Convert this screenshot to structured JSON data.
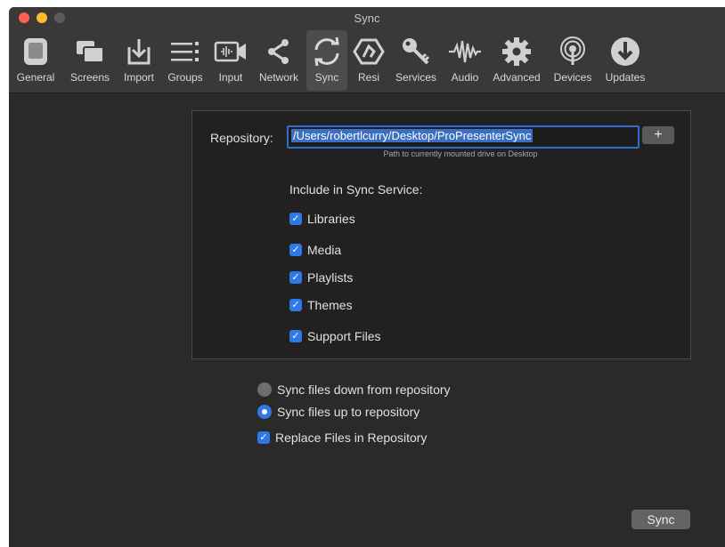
{
  "window": {
    "title": "Sync"
  },
  "toolbar": {
    "items": [
      {
        "label": "General",
        "icon": "general-icon"
      },
      {
        "label": "Screens",
        "icon": "screens-icon"
      },
      {
        "label": "Import",
        "icon": "import-icon"
      },
      {
        "label": "Groups",
        "icon": "groups-icon"
      },
      {
        "label": "Input",
        "icon": "input-icon"
      },
      {
        "label": "Network",
        "icon": "network-icon"
      },
      {
        "label": "Sync",
        "icon": "sync-icon",
        "active": true
      },
      {
        "label": "Resi",
        "icon": "resi-icon"
      },
      {
        "label": "Services",
        "icon": "key-icon"
      },
      {
        "label": "Audio",
        "icon": "audio-icon"
      },
      {
        "label": "Advanced",
        "icon": "gear-icon"
      },
      {
        "label": "Devices",
        "icon": "devices-icon"
      },
      {
        "label": "Updates",
        "icon": "updates-icon"
      }
    ]
  },
  "repository": {
    "label": "Repository:",
    "value": "/Users/robertlcurry/Desktop/ProPresenterSync",
    "hint": "Path to currently mounted drive on Desktop",
    "add_label": "+"
  },
  "include": {
    "label": "Include in Sync Service:",
    "items": [
      {
        "label": "Libraries",
        "checked": true
      },
      {
        "label": "Media",
        "checked": true
      },
      {
        "label": "Playlists",
        "checked": true
      },
      {
        "label": "Themes",
        "checked": true
      },
      {
        "label": "Support Files",
        "checked": true
      }
    ]
  },
  "options": {
    "sync_down": {
      "label": "Sync files down from repository",
      "selected": false
    },
    "sync_up": {
      "label": "Sync files up to repository",
      "selected": true
    },
    "replace": {
      "label": "Replace Files in Repository",
      "checked": true
    }
  },
  "sync_button": {
    "label": "Sync"
  },
  "colors": {
    "accent": "#2f78e8",
    "background": "#2b2a29",
    "panel": "#222120"
  }
}
